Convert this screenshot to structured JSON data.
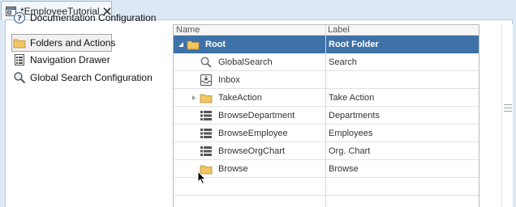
{
  "tab": {
    "title": "*EmployeeTutorial",
    "icon": "editor-window-icon",
    "close_icon": "close-icon"
  },
  "config_list": [
    {
      "label": "Documentation Configuration",
      "icon": "help-icon",
      "selected": false
    },
    {
      "label": "Folders and Actions",
      "icon": "folder-icon",
      "selected": true
    },
    {
      "label": "Navigation Drawer",
      "icon": "list-icon",
      "selected": false
    },
    {
      "label": "Global Search Configuration",
      "icon": "magnifier-icon",
      "selected": false
    }
  ],
  "tree": {
    "columns": {
      "name": "Name",
      "label": "Label"
    },
    "rows": [
      {
        "name": "Root",
        "label": "Root Folder",
        "icon": "folder-icon",
        "toggle": "expanded",
        "selected": true
      },
      {
        "name": "GlobalSearch",
        "label": "Search",
        "icon": "search-icon",
        "toggle": "none",
        "selected": false
      },
      {
        "name": "Inbox",
        "label": "",
        "icon": "inbox-icon",
        "toggle": "none",
        "selected": false
      },
      {
        "name": "TakeAction",
        "label": "Take Action",
        "icon": "folder-icon",
        "toggle": "collapsed",
        "selected": false
      },
      {
        "name": "BrowseDepartment",
        "label": "Departments",
        "icon": "list-view-icon",
        "toggle": "none",
        "selected": false
      },
      {
        "name": "BrowseEmployee",
        "label": "Employees",
        "icon": "list-view-icon",
        "toggle": "none",
        "selected": false
      },
      {
        "name": "BrowseOrgChart",
        "label": "Org. Chart",
        "icon": "list-view-icon",
        "toggle": "none",
        "selected": false
      },
      {
        "name": "Browse",
        "label": "Browse",
        "icon": "folder-icon",
        "toggle": "none",
        "selected": false
      }
    ]
  },
  "colors": {
    "selection": "#3e71a8",
    "folder": "#f2c661",
    "tab_bg": "#dce9f5"
  }
}
